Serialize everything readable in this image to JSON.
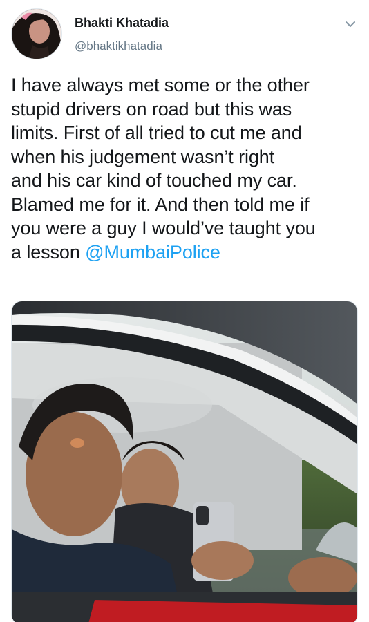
{
  "tweet": {
    "display_name": "Bhakti Khatadia",
    "handle": "@bhaktikhatadia",
    "text_lines": [
      "I have always met some or the other",
      "stupid drivers on road but this was",
      "limits. First of all tried to cut me and",
      "when his judgement wasn’t right",
      "and his car kind of touched my car.",
      "Blamed me for it. And then told me if",
      "you were a guy I would’ve taught you"
    ],
    "last_line_prefix": "a lesson ",
    "mention": "@MumbaiPolice"
  },
  "icons": {
    "menu": "chevron-down-icon"
  },
  "colors": {
    "link": "#1da1f2",
    "secondary_text": "#657786",
    "primary_text": "#14171a"
  }
}
